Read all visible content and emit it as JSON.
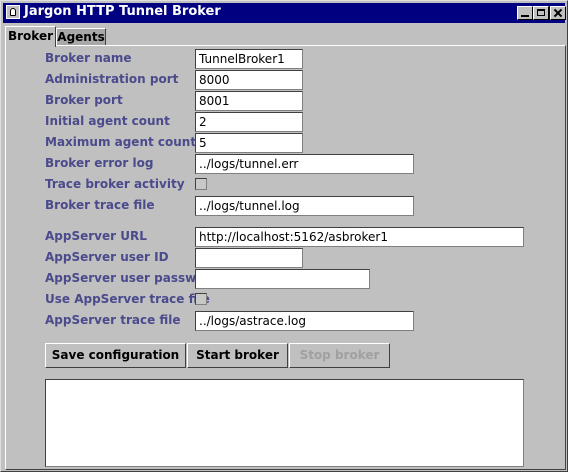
{
  "window": {
    "title": "Jargon HTTP Tunnel Broker"
  },
  "tabs": [
    {
      "label": "Broker",
      "active": true
    },
    {
      "label": "Agents",
      "active": false
    }
  ],
  "form": {
    "broker_name": {
      "label": "Broker name",
      "value": "TunnelBroker1"
    },
    "admin_port": {
      "label": "Administration port",
      "value": "8000"
    },
    "broker_port": {
      "label": "Broker port",
      "value": "8001"
    },
    "initial_agents": {
      "label": "Initial agent count",
      "value": "2"
    },
    "max_agents": {
      "label": "Maximum agent count",
      "value": "5"
    },
    "error_log": {
      "label": "Broker error log",
      "value": "../logs/tunnel.err"
    },
    "trace_activity": {
      "label": "Trace broker activity",
      "checked": false
    },
    "trace_file": {
      "label": "Broker trace file",
      "value": "../logs/tunnel.log"
    },
    "appserver_url": {
      "label": "AppServer URL",
      "value": "http://localhost:5162/asbroker1"
    },
    "appserver_user": {
      "label": "AppServer user ID",
      "value": ""
    },
    "appserver_password": {
      "label": "AppServer user password",
      "value": ""
    },
    "use_appserver_trace": {
      "label": "Use AppServer trace file",
      "checked": false
    },
    "appserver_trace_file": {
      "label": "AppServer trace file",
      "value": "../logs/astrace.log"
    }
  },
  "buttons": {
    "save": "Save configuration",
    "start": "Start broker",
    "stop": "Stop broker"
  },
  "log_output": ""
}
